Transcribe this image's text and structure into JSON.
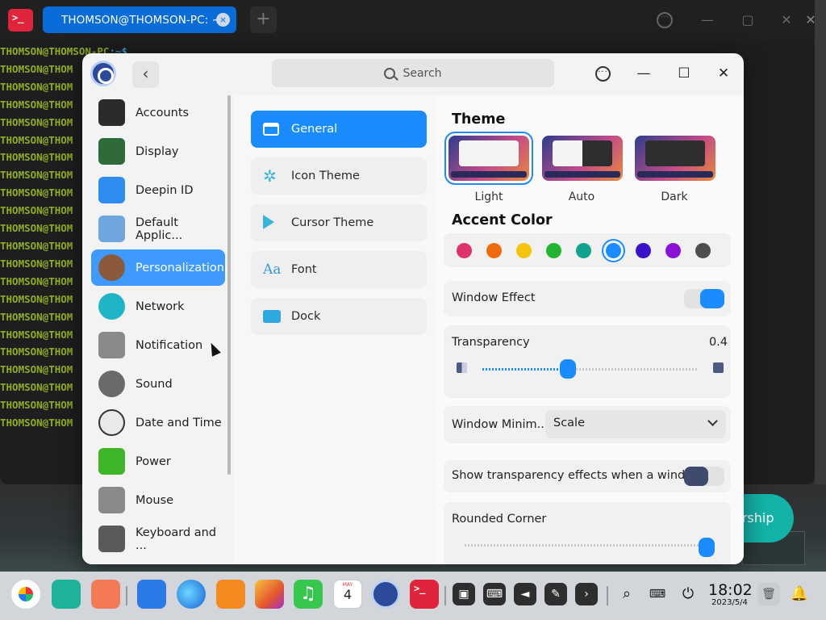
{
  "terminal": {
    "tab_title": "THOMSON@THOMSON-PC: ~",
    "tab_close": "×",
    "add_tab": "+",
    "prompt_user": "THOMSON@THOMSON-PC",
    "prompt_rest": ":~$",
    "line_text": "THOMSON@THOM",
    "line_count": 21
  },
  "background": {
    "button_partial_label": "ership"
  },
  "control_center": {
    "search_placeholder": "Search",
    "sidebar": [
      {
        "label": "Accounts",
        "icon": "accounts-icon"
      },
      {
        "label": "Display",
        "icon": "display-icon"
      },
      {
        "label": "Deepin ID",
        "icon": "cloud-icon"
      },
      {
        "label": "Default Applic...",
        "icon": "default-apps-icon"
      },
      {
        "label": "Personalization",
        "icon": "palette-icon",
        "active": true
      },
      {
        "label": "Network",
        "icon": "network-icon"
      },
      {
        "label": "Notification",
        "icon": "bell-icon"
      },
      {
        "label": "Sound",
        "icon": "speaker-icon"
      },
      {
        "label": "Date and Time",
        "icon": "clock-icon"
      },
      {
        "label": "Power",
        "icon": "battery-icon"
      },
      {
        "label": "Mouse",
        "icon": "mouse-icon"
      },
      {
        "label": "Keyboard and ...",
        "icon": "keyboard-icon"
      }
    ],
    "middle": [
      {
        "label": "General",
        "icon": "window-icon",
        "active": true
      },
      {
        "label": "Icon Theme",
        "icon": "flower-icon"
      },
      {
        "label": "Cursor Theme",
        "icon": "cursor-icon"
      },
      {
        "label": "Font",
        "icon": "font-icon"
      },
      {
        "label": "Dock",
        "icon": "dock-icon"
      }
    ],
    "right": {
      "theme_heading": "Theme",
      "themes": [
        {
          "label": "Light",
          "selected": true
        },
        {
          "label": "Auto"
        },
        {
          "label": "Dark"
        }
      ],
      "accent_heading": "Accent Color",
      "accent_colors": [
        "#e0326a",
        "#f06a10",
        "#f5c30a",
        "#22b532",
        "#10a48f",
        "#1a8cff",
        "#3a12c8",
        "#8a12d8",
        "#4e4e4e"
      ],
      "accent_selected_index": 5,
      "window_effect_label": "Window Effect",
      "window_effect_on": true,
      "transparency_label": "Transparency",
      "transparency_value": "0.4",
      "transparency_level": 0.4,
      "window_minimize_label": "Window Minim...",
      "window_minimize_value": "Scale",
      "show_transparency_label": "Show transparency effects when a windo...",
      "show_transparency_on": false,
      "rounded_corner_label": "Rounded Corner",
      "rounded_corner_level": 1.0
    }
  },
  "taskbar": {
    "time": "18:02",
    "date": "2023/5/4",
    "calendar_month": "MAY",
    "calendar_day": "4"
  }
}
